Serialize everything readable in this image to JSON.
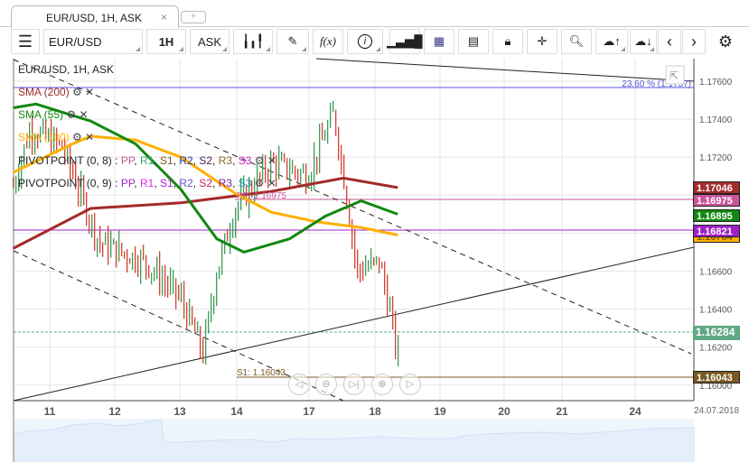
{
  "tab": {
    "title": "EUR/USD, 1H, ASK",
    "close": "×",
    "new": "+"
  },
  "toolbar": {
    "symbol": "EUR/USD",
    "timeframe": "1H",
    "price_type": "ASK"
  },
  "icons": [
    "menu-icon",
    "candles-icon",
    "draw-icon",
    "function-icon",
    "info-icon",
    "volume-bars-icon",
    "calendar-icon",
    "news-icon",
    "lock-icon",
    "crosshair-icon",
    "zoom-chart-icon",
    "upload-cloud-icon",
    "download-cloud-icon",
    "prev-icon",
    "next-icon",
    "gear-icon"
  ],
  "legend": {
    "title": "EUR/USD, 1H, ASK",
    "sma200": "SMA (200)",
    "sma55": "SMA (55)",
    "sma100": "SMA (100)",
    "pivot8": "PIVOTPOINT (0, 8)",
    "pivot9": "PIVOTPOINT (0, 9)",
    "sep": " : ",
    "pp": "PP",
    "r1": "R1",
    "s1": "S1",
    "r2": "R2",
    "s2": "S2",
    "r3": "R3",
    "s3": "S3",
    "comma": ", "
  },
  "fib_label": "23.60 % (1.1757)",
  "pp_label": "PP: 1.16975",
  "s1_label": "S1: 1.16043",
  "price_axis": [
    "1.17600",
    "1.17400",
    "1.17200",
    "1.16600",
    "1.16400",
    "1.16200",
    "1.16000"
  ],
  "price_boxes": [
    {
      "value": "1.17046",
      "color": "#a52a2a"
    },
    {
      "value": "1.16975",
      "color": "#c9559a"
    },
    {
      "value": "1.16895",
      "color": "#118811"
    },
    {
      "value": "1.16821",
      "color": "#a020c8"
    },
    {
      "value": "1.16784",
      "color": "#ffb000"
    },
    {
      "value": "1.16284",
      "color": "#5fa883"
    },
    {
      "value": "1.16043",
      "color": "#7a5a22"
    }
  ],
  "time_axis": [
    "11",
    "12",
    "13",
    "14",
    "17",
    "18",
    "19",
    "20",
    "21",
    "24"
  ],
  "date_label": "24.07.2018",
  "chart_data": {
    "type": "candlestick",
    "price_path": [
      [
        -0.56,
        1.1705
      ],
      [
        -0.3,
        1.1735
      ],
      [
        0.2,
        1.1725
      ],
      [
        0.76,
        1.1675
      ],
      [
        1.46,
        1.1665
      ],
      [
        2.01,
        1.1646
      ],
      [
        2.41,
        1.1617
      ],
      [
        2.65,
        1.166
      ],
      [
        2.97,
        1.1693
      ],
      [
        3.48,
        1.1717
      ],
      [
        3.98,
        1.171
      ],
      [
        4.38,
        1.1743
      ],
      [
        4.59,
        1.1695
      ],
      [
        4.73,
        1.166
      ],
      [
        5.07,
        1.1665
      ],
      [
        5.28,
        1.163
      ],
      [
        5.35,
        1.161
      ],
      [
        5.37,
        1.1628
      ]
    ],
    "sma200": [
      [
        -0.56,
        1.1672
      ],
      [
        0.63,
        1.1693
      ],
      [
        2.02,
        1.1696
      ],
      [
        3.48,
        1.1702
      ],
      [
        4.52,
        1.1709
      ],
      [
        5.35,
        1.1704
      ]
    ],
    "sma55": [
      [
        -0.56,
        1.1746
      ],
      [
        -0.21,
        1.1748
      ],
      [
        0.63,
        1.1739
      ],
      [
        1.32,
        1.1727
      ],
      [
        2.02,
        1.1703
      ],
      [
        2.65,
        1.1677
      ],
      [
        3.1,
        1.167
      ],
      [
        3.73,
        1.1677
      ],
      [
        4.25,
        1.1689
      ],
      [
        4.79,
        1.1697
      ],
      [
        5.35,
        1.169
      ]
    ],
    "sma100": [
      [
        -0.56,
        1.1712
      ],
      [
        0.35,
        1.1727
      ],
      [
        0.63,
        1.1731
      ],
      [
        1.32,
        1.1729
      ],
      [
        2.02,
        1.172
      ],
      [
        2.97,
        1.1701
      ],
      [
        3.48,
        1.1691
      ],
      [
        4.11,
        1.1686
      ],
      [
        4.79,
        1.1683
      ],
      [
        5.35,
        1.1679
      ]
    ],
    "colors": {
      "up": "#3a9a55",
      "down": "#d04030",
      "sma200": "#a52a2a",
      "sma55": "#118811",
      "sma100": "#ffb000"
    }
  }
}
